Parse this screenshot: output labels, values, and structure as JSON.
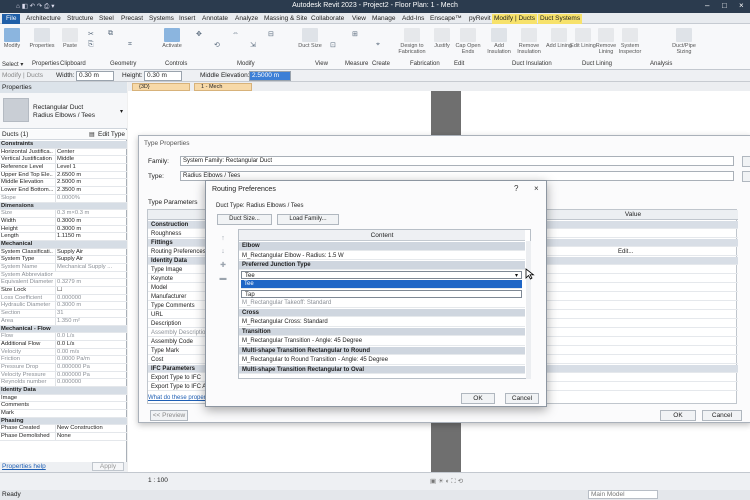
{
  "window": {
    "title": "Autodesk Revit 2023 - Project2 - Floor Plan: 1 - Mech"
  },
  "ribbon_tabs": [
    "File",
    "Architecture",
    "Structure",
    "Steel",
    "Precast",
    "Systems",
    "Insert",
    "Annotate",
    "Analyze",
    "Massing & Site",
    "Collaborate",
    "View",
    "Manage",
    "Add-Ins",
    "Enscape™",
    "pyRevit",
    "Modify | Ducts",
    "Duct Systems"
  ],
  "ribbon": {
    "buttons": [
      {
        "label": "Modify"
      },
      {
        "label": "Properties"
      },
      {
        "label": "Paste"
      },
      {
        "label": "Activate"
      },
      {
        "label": "Duct Size"
      },
      {
        "label": "Design to Fabrication"
      },
      {
        "label": "Justify"
      },
      {
        "label": "Cap Open Ends"
      },
      {
        "label": "Add Insulation"
      },
      {
        "label": "Remove Insulation"
      },
      {
        "label": "Add Lining"
      },
      {
        "label": "Edit Lining"
      },
      {
        "label": "Remove Lining"
      },
      {
        "label": "System Inspector"
      },
      {
        "label": "Duct/Pipe Sizing"
      }
    ],
    "panels": [
      "Select ▾",
      "Properties",
      "Clipboard",
      "Geometry",
      "Controls",
      "Modify",
      "View",
      "Measure",
      "Create",
      "Fabrication",
      "Edit",
      "Duct Insulation",
      "Duct Lining",
      "Analysis"
    ]
  },
  "options_bar": {
    "context": "Modify | Ducts",
    "width_label": "Width:",
    "width_value": "0.30 m",
    "height_label": "Height:",
    "height_value": "0.30 m",
    "elev_label": "Middle Elevation:",
    "elev_value": "2.5000 m"
  },
  "properties": {
    "header": "Properties",
    "type_name_1": "Rectangular Duct",
    "type_name_2": "Radius Elbows / Tees",
    "instance": "Ducts (1)",
    "edit_type": "Edit Type",
    "rows": [
      {
        "k": "Constraints",
        "v": "",
        "cat": true
      },
      {
        "k": "Horizontal Justifica...",
        "v": "Center"
      },
      {
        "k": "Vertical Justification",
        "v": "Middle"
      },
      {
        "k": "Reference Level",
        "v": "Level 1"
      },
      {
        "k": "Upper End Top Ele...",
        "v": "2.6500 m"
      },
      {
        "k": "Middle Elevation",
        "v": "2.5000 m"
      },
      {
        "k": "Lower End Bottom...",
        "v": "2.3500 m"
      },
      {
        "k": "Slope",
        "v": "0.0000%",
        "gray": true
      },
      {
        "k": "Dimensions",
        "v": "",
        "cat": true
      },
      {
        "k": "Size",
        "v": "0.3 m×0.3 m",
        "gray": true
      },
      {
        "k": "Width",
        "v": "0.3000 m"
      },
      {
        "k": "Height",
        "v": "0.3000 m"
      },
      {
        "k": "Length",
        "v": "1.1150 m"
      },
      {
        "k": "Mechanical",
        "v": "",
        "cat": true
      },
      {
        "k": "System Classificati...",
        "v": "Supply Air"
      },
      {
        "k": "System Type",
        "v": "Supply Air"
      },
      {
        "k": "System Name",
        "v": "Mechanical Supply ...",
        "gray": true
      },
      {
        "k": "System Abbreviation",
        "v": "",
        "gray": true
      },
      {
        "k": "Equivalent Diameter",
        "v": "0.3279 m",
        "gray": true
      },
      {
        "k": "Size Lock",
        "v": "☐"
      },
      {
        "k": "Loss Coefficient",
        "v": "0.000000",
        "gray": true
      },
      {
        "k": "Hydraulic Diameter",
        "v": "0.3000 m",
        "gray": true
      },
      {
        "k": "Section",
        "v": "31",
        "gray": true
      },
      {
        "k": "Area",
        "v": "1.350 m²",
        "gray": true
      },
      {
        "k": "Mechanical - Flow",
        "v": "",
        "cat": true
      },
      {
        "k": "Flow",
        "v": "0.0 L/s",
        "gray": true
      },
      {
        "k": "Additional Flow",
        "v": "0.0 L/s"
      },
      {
        "k": "Velocity",
        "v": "0.00 m/s",
        "gray": true
      },
      {
        "k": "Friction",
        "v": "0.0000 Pa/m",
        "gray": true
      },
      {
        "k": "Pressure Drop",
        "v": "0.000000 Pa",
        "gray": true
      },
      {
        "k": "Velocity Pressure",
        "v": "0.000000 Pa",
        "gray": true
      },
      {
        "k": "Reynolds number",
        "v": "0.000000",
        "gray": true
      },
      {
        "k": "Identity Data",
        "v": "",
        "cat": true
      },
      {
        "k": "Image",
        "v": ""
      },
      {
        "k": "Comments",
        "v": ""
      },
      {
        "k": "Mark",
        "v": ""
      },
      {
        "k": "Phasing",
        "v": "",
        "cat": true
      },
      {
        "k": "Phase Created",
        "v": "New Construction"
      },
      {
        "k": "Phase Demolished",
        "v": "None"
      }
    ],
    "help": "Properties help",
    "apply": "Apply"
  },
  "view_tabs": [
    "{3D}",
    "1 - Mech"
  ],
  "type_properties": {
    "title": "Type Properties",
    "family_label": "Family:",
    "family_value": "System Family: Rectangular Duct",
    "type_label": "Type:",
    "type_value": "Radius Elbows / Tees",
    "params_label": "Type Parameters",
    "value_header": "Value",
    "rows": [
      {
        "k": "Construction",
        "cat": true
      },
      {
        "k": "Roughness"
      },
      {
        "k": "Fittings",
        "cat": true
      },
      {
        "k": "Routing Preferences",
        "v": "Edit..."
      },
      {
        "k": "Identity Data",
        "cat": true
      },
      {
        "k": "Type Image"
      },
      {
        "k": "Keynote"
      },
      {
        "k": "Model"
      },
      {
        "k": "Manufacturer"
      },
      {
        "k": "Type Comments"
      },
      {
        "k": "URL"
      },
      {
        "k": "Description"
      },
      {
        "k": "Assembly Description",
        "gray": true
      },
      {
        "k": "Assembly Code"
      },
      {
        "k": "Type Mark"
      },
      {
        "k": "Cost"
      },
      {
        "k": "IFC Parameters",
        "cat": true
      },
      {
        "k": "Export Type to IFC"
      },
      {
        "k": "Export Type to IFC As"
      }
    ],
    "help_link": "What do these properties do?",
    "preview": "<< Preview",
    "ok": "OK",
    "cancel": "Cancel"
  },
  "routing": {
    "title": "Routing Preferences",
    "duct_type": "Duct Type: Radius Elbows / Tees",
    "duct_size_btn": "Duct Size...",
    "load_family_btn": "Load Family...",
    "content_header": "Content",
    "rows": [
      {
        "t": "Elbow",
        "style": "cat"
      },
      {
        "t": "M_Rectangular Elbow - Radius: 1.5 W"
      },
      {
        "t": "Preferred Junction Type",
        "style": "cat"
      },
      {
        "t": "Tee",
        "style": "sel"
      },
      {
        "t": "Tee",
        "style": "sel"
      },
      {
        "t": "Tap",
        "style": "list"
      },
      {
        "t": "M_Rectangular Takeoff: Standard",
        "style": "gray"
      },
      {
        "t": "Cross",
        "style": "cat"
      },
      {
        "t": "M_Rectangular Cross: Standard"
      },
      {
        "t": "Transition",
        "style": "cat"
      },
      {
        "t": "M_Rectangular Transition - Angle: 45 Degree"
      },
      {
        "t": "Multi-shape Transition Rectangular to Round",
        "style": "cat"
      },
      {
        "t": "M_Rectangular to Round Transition - Angle: 45 Degree"
      },
      {
        "t": "Multi-shape Transition Rectangular to Oval",
        "style": "cat"
      }
    ],
    "ok": "OK",
    "cancel": "Cancel"
  },
  "status": {
    "scale": "1 : 100",
    "ready": "Ready",
    "workset": "Main Model"
  }
}
